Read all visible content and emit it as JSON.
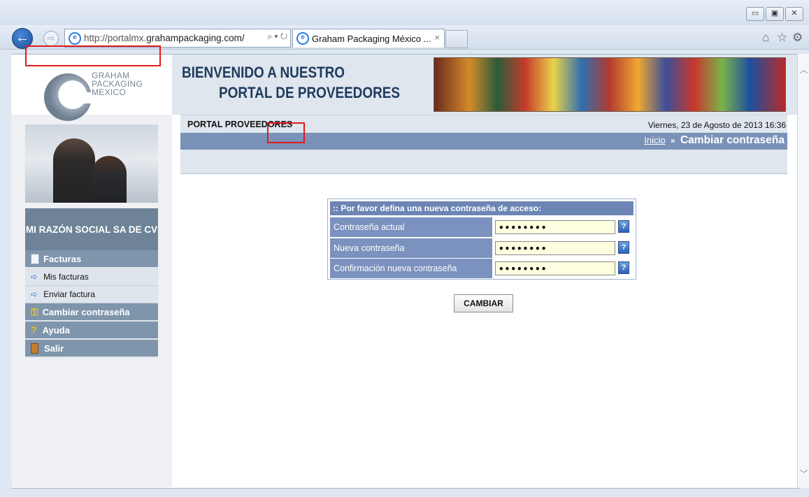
{
  "browser": {
    "url_prefix": "http://portalmx.",
    "url_domain": "grahampackaging.com/",
    "url_tail": "⌕ ▾ ↻",
    "tab_title": "Graham Packaging México ...",
    "tab_close": "×",
    "window_buttons": [
      "▭",
      "▣",
      "✕"
    ],
    "right_icons": [
      "⌂",
      "☆",
      "⚙"
    ]
  },
  "logo": {
    "line1": "GRAHAM",
    "line2": "PACKAGING",
    "line3": "MEXICO"
  },
  "header": {
    "welcome_line1": "BIENVENIDO A NUESTRO",
    "welcome_line2": "PORTAL DE PROVEEDORES"
  },
  "topbar": {
    "portal_label": "PORTAL PROVEEDORES",
    "date": "Viernes, 23 de Agosto de 2013 16:36"
  },
  "breadcrumb": {
    "home": "Inicio",
    "separator": "»",
    "current": "Cambiar contraseña"
  },
  "sidebar": {
    "company": "MI RAZÓN SOCIAL SA DE CV",
    "items": [
      {
        "label": "Facturas",
        "icon": "document-icon"
      },
      {
        "label": "Mis facturas",
        "icon": "arrow-icon"
      },
      {
        "label": "Enviar factura",
        "icon": "arrow-icon"
      },
      {
        "label": "Cambiar contraseña",
        "icon": "users-key-icon"
      },
      {
        "label": "Ayuda",
        "icon": "question-icon"
      },
      {
        "label": "Salir",
        "icon": "exit-door-icon"
      }
    ]
  },
  "form": {
    "heading": ":: Por favor defina una nueva contraseña de acceso:",
    "fields": [
      {
        "label": "Contraseña actual",
        "value": "••••••••"
      },
      {
        "label": "Nueva contraseña",
        "value": "••••••••"
      },
      {
        "label": "Confirmación nueva contraseña",
        "value": "••••••••"
      }
    ],
    "help_glyph": "?",
    "submit_label": "CAMBIAR"
  },
  "colors": {
    "accent": "#7b92be",
    "sidebar": "#7f95ac",
    "highlight": "#e21b1b"
  }
}
